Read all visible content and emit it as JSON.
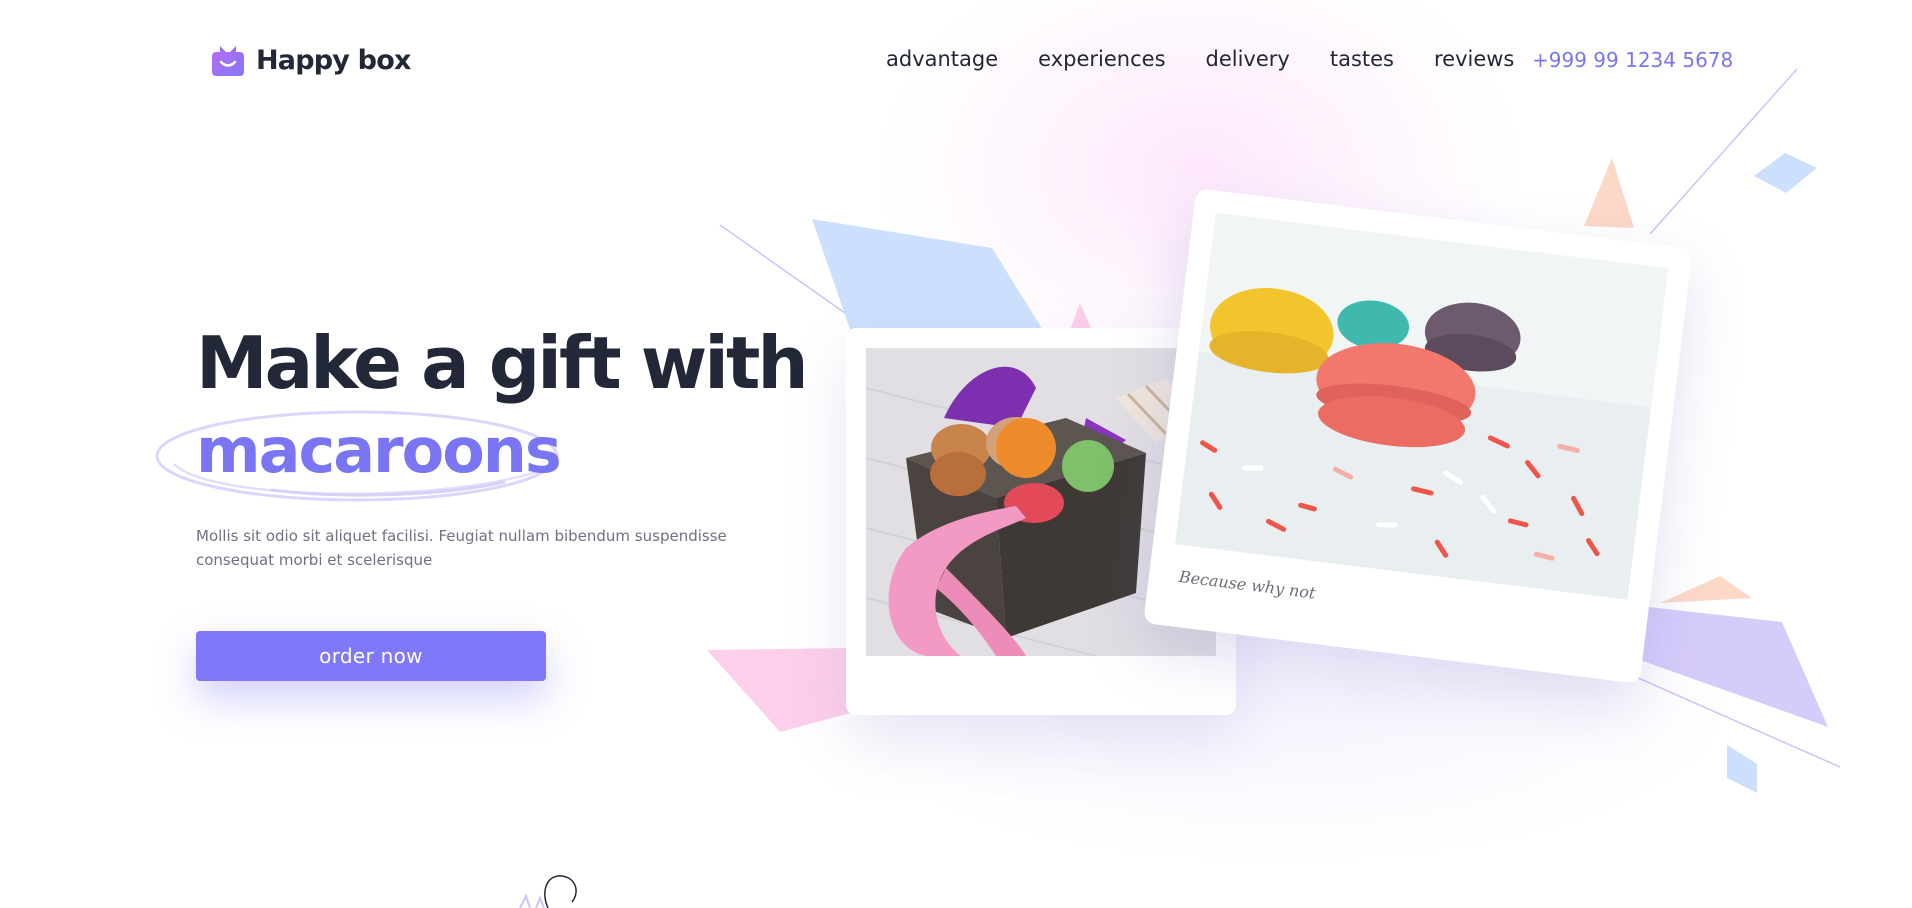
{
  "header": {
    "logo_text": "Happy box",
    "nav": [
      {
        "label": "advantage"
      },
      {
        "label": "experiences"
      },
      {
        "label": "delivery"
      },
      {
        "label": "tastes"
      },
      {
        "label": "reviews"
      }
    ],
    "phone": "+999 99 1234 5678"
  },
  "hero": {
    "title_line1": "Make a gift with",
    "title_highlight": "macaroons",
    "description": "Mollis sit odio sit aliquet facilisi. Feugiat nullam bibendum suspendisse consequat morbi et scelerisque",
    "cta_label": "order now"
  },
  "photos": {
    "caption": "Because why not"
  },
  "colors": {
    "accent": "#7F78F8",
    "accent_text": "#7A75F2",
    "heading": "#232838",
    "body_text": "#6E7283",
    "shape_blue": "#CCE0FD",
    "shape_pink": "#FDCFEB",
    "shape_peach": "#FCD8C7",
    "shape_lilac": "#D6CCFB"
  },
  "icons": {
    "logo": "gift-box-smile-icon"
  }
}
